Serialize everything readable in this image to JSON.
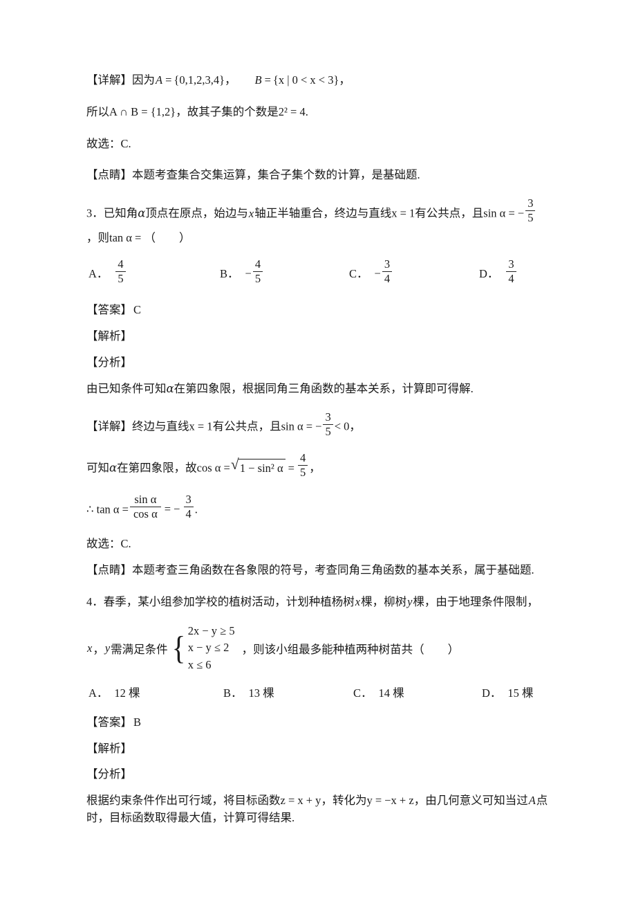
{
  "document": {
    "type": "math-exam-solutions",
    "language": "zh-CN"
  },
  "labels": {
    "detail": "【详解】",
    "insight": "【点睛】",
    "answer": "【答案】",
    "explanation": "【解析】",
    "analysis": "【分析】"
  },
  "q2_tail": {
    "detail_prefix": "【详解】",
    "detail_text": "因为",
    "set_a": "A = {0,1,2,3,4}",
    "set_a_name": "A",
    "set_a_body": "{0,1,2,3,4}",
    "comma1": "，",
    "set_b_name": "B",
    "set_b_body": "{x | 0 < x < 3}",
    "comma2": "，",
    "line2_prefix": "所以",
    "line2_inter": "A ∩ B = {1,2}",
    "line2_mid": "，故其子集的个数是",
    "line2_pow": "2² = 4",
    "line2_end": ".",
    "choose": "故选：C.",
    "insight": "【点睛】本题考查集合交集运算，集合子集个数的计算，是基础题."
  },
  "q3": {
    "number": "3．",
    "stem_part1": "已知角",
    "stem_alpha": "α",
    "stem_part2": "顶点在原点，始边与",
    "stem_x": "x",
    "stem_part3": "轴正半轴重合，终边与直线",
    "stem_eq": "x = 1",
    "stem_part4": "有公共点，且",
    "stem_sin": "sin α = −",
    "stem_frac_num": "3",
    "stem_frac_den": "5",
    "line2_comma": "，则",
    "line2_tan": "tan α = （",
    "line2_close": "）",
    "options": [
      {
        "label": "A．",
        "sign": "",
        "num": "4",
        "den": "5"
      },
      {
        "label": "B．",
        "sign": "−",
        "num": "4",
        "den": "5"
      },
      {
        "label": "C．",
        "sign": "−",
        "num": "3",
        "den": "4"
      },
      {
        "label": "D．",
        "sign": "",
        "num": "3",
        "den": "4"
      }
    ],
    "answer_label": "【答案】",
    "answer_value": "C",
    "explanation_label": "【解析】",
    "analysis_label": "【分析】",
    "analysis_text_1": "由已知条件可知",
    "analysis_alpha": "α",
    "analysis_text_2": "在第四象限，根据同角三角函数的基本关系，计算即可得解.",
    "detail_label": "【详解】",
    "detail_text_1": "终边与直线",
    "detail_eq": "x = 1",
    "detail_text_2": "有公共点，且",
    "detail_sin": "sin α = −",
    "detail_frac_num": "3",
    "detail_frac_den": "5",
    "detail_lt": "< 0",
    "detail_comma": "，",
    "detail2_text_1": "可知",
    "detail2_alpha": "α",
    "detail2_text_2": "在第四象限，故",
    "detail2_cos": "cos α =",
    "detail2_radicand": "1 − sin² α",
    "detail2_eq": "=",
    "detail2_num": "4",
    "detail2_den": "5",
    "detail2_comma": "，",
    "tan_therefore": "∴",
    "tan_lhs": "tan α =",
    "tan_frac_num": "sin α",
    "tan_frac_den": "cos α",
    "tan_eq": "= −",
    "tan_val_num": "3",
    "tan_val_den": "4",
    "tan_period": ".",
    "choose": "故选：C.",
    "insight": "【点睛】本题考查三角函数在各象限的符号，考查同角三角函数的基本关系，属于基础题."
  },
  "q4": {
    "number": "4．",
    "stem_1": "春季，某小组参加学校的植树活动，计划种植杨树",
    "stem_x": "x",
    "stem_2": "棵，柳树",
    "stem_y": "y",
    "stem_3": "棵，由于地理条件限制，",
    "cond_x": "x",
    "cond_comma": "，",
    "cond_y": "y",
    "cond_text": "需满足条件",
    "system": [
      "2x − y ≥ 5",
      "x − y ≤ 2",
      "x ≤ 6"
    ],
    "after_system": "，则该小组最多能种植两种树苗共（",
    "after_close": "）",
    "options": [
      {
        "label": "A．",
        "text": "12 棵"
      },
      {
        "label": "B．",
        "text": "13 棵"
      },
      {
        "label": "C．",
        "text": "14 棵"
      },
      {
        "label": "D．",
        "text": "15 棵"
      }
    ],
    "answer_label": "【答案】",
    "answer_value": "B",
    "explanation_label": "【解析】",
    "analysis_label": "【分析】",
    "analysis_1": "根据约束条件作出可行域，将目标函数",
    "analysis_z": "z = x + y",
    "analysis_2": "，转化为",
    "analysis_y": "y = −x + z",
    "analysis_3": "，由几何意义可知当过",
    "analysis_A": "A",
    "analysis_4": "点时，目标函数取得最大值，计算可得结果."
  }
}
